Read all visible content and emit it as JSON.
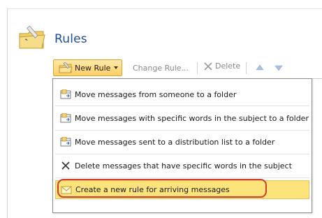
{
  "page": {
    "title": "Rules",
    "icon": "rules-folder-icon"
  },
  "toolbar": {
    "new_rule_label": "New Rule",
    "new_rule_icon": "new-rule-icon",
    "change_rule_label": "Change Rule...",
    "delete_label": "Delete",
    "move_up_icon": "arrow-up-icon",
    "move_down_icon": "arrow-down-icon"
  },
  "menu": {
    "items": [
      {
        "label": "Move messages from someone to a folder",
        "icon": "move-to-folder-icon"
      },
      {
        "label": "Move messages with specific words in the subject to a folder",
        "icon": "move-to-folder-icon"
      },
      {
        "label": "Move messages sent to a distribution list to a folder",
        "icon": "move-to-folder-icon"
      },
      {
        "label": "Delete messages that have specific words in the subject",
        "icon": "delete-x-icon"
      },
      {
        "label": "Create a new rule for arriving messages",
        "icon": "envelope-icon",
        "highlighted": true
      }
    ]
  },
  "colors": {
    "title": "#1f4e99",
    "highlight": "#fce37a",
    "callout": "#d13c2f"
  }
}
